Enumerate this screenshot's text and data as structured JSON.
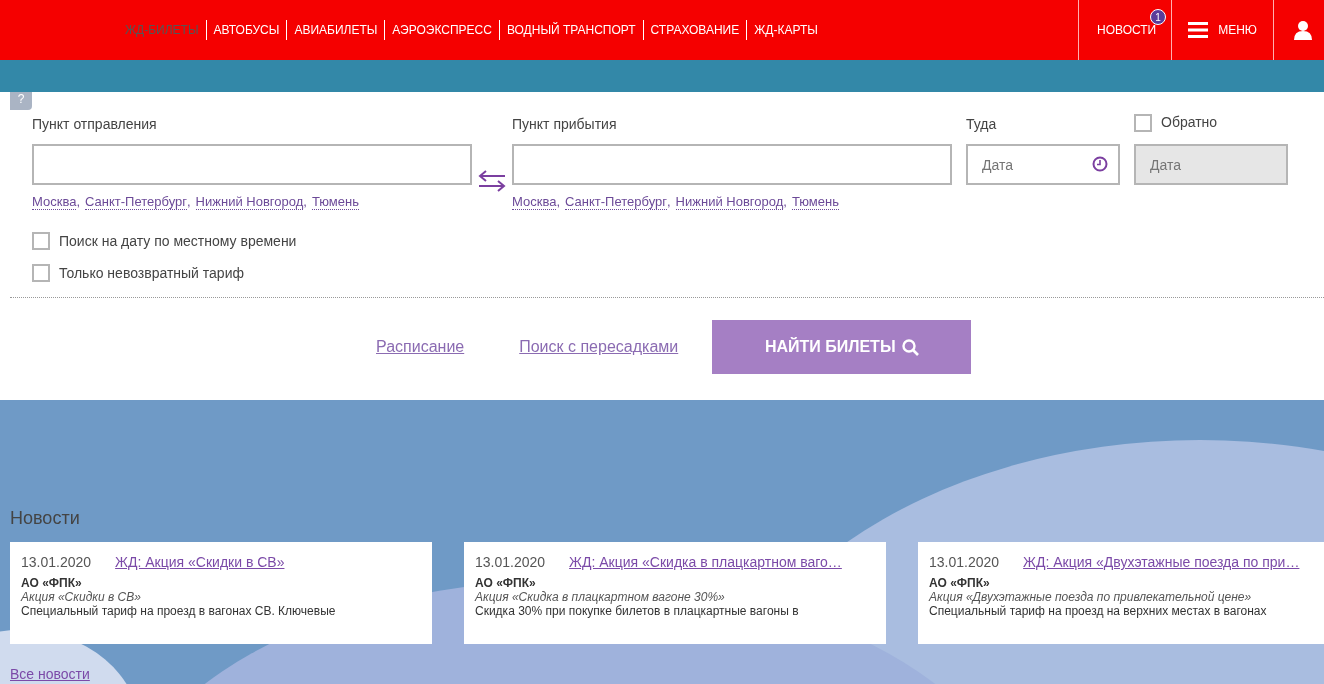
{
  "nav": {
    "items": [
      {
        "label": "ЖД-БИЛЕТЫ",
        "selected": true
      },
      {
        "label": "АВТОБУСЫ",
        "selected": false
      },
      {
        "label": "АВИАБИЛЕТЫ",
        "selected": false
      },
      {
        "label": "АЭРОЭКСПРЕСС",
        "selected": false
      },
      {
        "label": "ВОДНЫЙ ТРАНСПОРТ",
        "selected": false
      },
      {
        "label": "СТРАХОВАНИЕ",
        "selected": false
      },
      {
        "label": "ЖД-КАРТЫ",
        "selected": false
      }
    ],
    "news": {
      "label": "НОВОСТИ",
      "badge": "1"
    },
    "menu": {
      "label": "МЕНЮ"
    }
  },
  "help": "?",
  "separator": ",",
  "form": {
    "departure": {
      "label": "Пункт отправления",
      "suggestions": [
        "Москва",
        "Санкт-Петербург",
        "Нижний Новгород",
        "Тюмень"
      ]
    },
    "arrival": {
      "label": "Пункт прибытия",
      "suggestions": [
        "Москва",
        "Санкт-Петербург",
        "Нижний Новгород",
        "Тюмень"
      ]
    },
    "there": {
      "label": "Туда",
      "placeholder": "Дата"
    },
    "back": {
      "label": "Обратно",
      "checked": false,
      "placeholder": "Дата",
      "disabled": true
    },
    "options": [
      {
        "label": "Поиск на дату по местному времени",
        "checked": false
      },
      {
        "label": "Только невозвратный тариф",
        "checked": false
      }
    ],
    "links": [
      "Расписание",
      "Поиск с пересадками"
    ],
    "submit": "НАЙТИ БИЛЕТЫ"
  },
  "news": {
    "title": "Новости",
    "cards": [
      {
        "date": "13.01.2020",
        "title": "ЖД: Акция «Скидки в СВ»",
        "company": "АО «ФПК»",
        "subtitle": "Акция «Скидки в СВ»",
        "text": "Специальный тариф на проезд в вагонах СВ. Ключевые"
      },
      {
        "date": "13.01.2020",
        "title": "ЖД: Акция «Скидка в плацкартном ваго…",
        "company": "АО «ФПК»",
        "subtitle": "Акция «Скидка в плацкартном вагоне 30%»",
        "text": "Скидка 30% при покупке билетов в плацкартные вагоны в"
      },
      {
        "date": "13.01.2020",
        "title": "ЖД: Акция «Двухэтажные поезда по при…",
        "company": "АО «ФПК»",
        "subtitle": "Акция «Двухэтажные поезда по привлекательной цене»",
        "text": "Специальный тариф на проезд на верхних местах в вагонах"
      }
    ],
    "all": "Все новости"
  }
}
